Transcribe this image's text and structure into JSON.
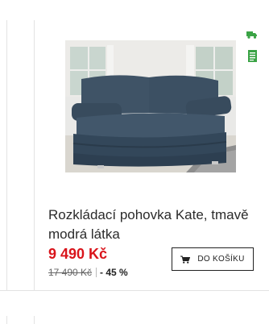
{
  "product": {
    "title": "Rozkládací pohovka Kate, tmavě modrá látka",
    "price": "9 490 Kč",
    "old_price": "17 490 Kč",
    "discount": "- 45 %",
    "add_to_cart_label": "DO KOŠÍKU",
    "image_alt": "Rozkládací pohovka Kate",
    "badges": [
      "delivery-truck-icon",
      "document-icon"
    ]
  },
  "colors": {
    "price": "#d9141b",
    "badge": "#3aa345",
    "text": "#2b2b2b",
    "border": "#e3e3e3"
  }
}
